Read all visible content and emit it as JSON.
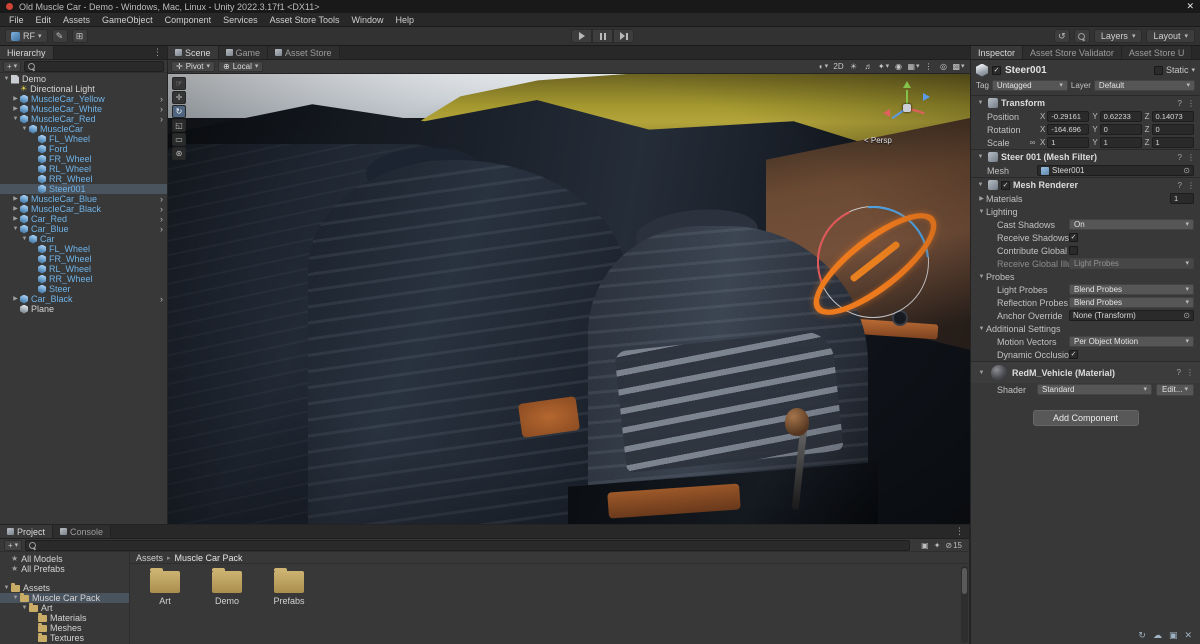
{
  "title_bar": {
    "title": "Old Muscle Car - Demo - Windows, Mac, Linux - Unity 2022.3.17f1 <DX11>"
  },
  "menu_bar": [
    "File",
    "Edit",
    "Assets",
    "GameObject",
    "Component",
    "Services",
    "Asset Store Tools",
    "Window",
    "Help"
  ],
  "toolbar": {
    "account_label": "RF",
    "layers_label": "Layers",
    "layout_label": "Layout"
  },
  "hierarchy": {
    "tab_label": "Hierarchy",
    "create_label": "+",
    "items": [
      {
        "label": "Demo",
        "depth": 0,
        "icon": "scene",
        "arrow": "down"
      },
      {
        "label": "Directional Light",
        "depth": 1,
        "icon": "light"
      },
      {
        "label": "MuscleCar_Yellow",
        "depth": 1,
        "icon": "prefab",
        "blue": true,
        "arrow": "right",
        "chev": true
      },
      {
        "label": "MuscleCar_White",
        "depth": 1,
        "icon": "prefab",
        "blue": true,
        "arrow": "right",
        "chev": true
      },
      {
        "label": "MuscleCar_Red",
        "depth": 1,
        "icon": "prefab",
        "blue": true,
        "arrow": "down",
        "chev": true
      },
      {
        "label": "MuscleCar",
        "depth": 2,
        "icon": "prefab",
        "blue": true,
        "arrow": "down"
      },
      {
        "label": "FL_Wheel",
        "depth": 3,
        "icon": "prefab",
        "blue": true
      },
      {
        "label": "Ford",
        "depth": 3,
        "icon": "prefab",
        "blue": true
      },
      {
        "label": "FR_Wheel",
        "depth": 3,
        "icon": "prefab",
        "blue": true
      },
      {
        "label": "RL_Wheel",
        "depth": 3,
        "icon": "prefab",
        "blue": true
      },
      {
        "label": "RR_Wheel",
        "depth": 3,
        "icon": "prefab",
        "blue": true
      },
      {
        "label": "Steer001",
        "depth": 3,
        "icon": "prefab",
        "blue": true,
        "selected": true
      },
      {
        "label": "MuscleCar_Blue",
        "depth": 1,
        "icon": "prefab",
        "blue": true,
        "arrow": "right",
        "chev": true
      },
      {
        "label": "MuscleCar_Black",
        "depth": 1,
        "icon": "prefab",
        "blue": true,
        "arrow": "right",
        "chev": true
      },
      {
        "label": "Car_Red",
        "depth": 1,
        "icon": "prefab",
        "blue": true,
        "arrow": "right",
        "chev": true
      },
      {
        "label": "Car_Blue",
        "depth": 1,
        "icon": "prefab",
        "blue": true,
        "arrow": "down",
        "chev": true
      },
      {
        "label": "Car",
        "depth": 2,
        "icon": "prefab",
        "blue": true,
        "arrow": "down"
      },
      {
        "label": "FL_Wheel",
        "depth": 3,
        "icon": "prefab",
        "blue": true
      },
      {
        "label": "FR_Wheel",
        "depth": 3,
        "icon": "prefab",
        "blue": true
      },
      {
        "label": "RL_Wheel",
        "depth": 3,
        "icon": "prefab",
        "blue": true
      },
      {
        "label": "RR_Wheel",
        "depth": 3,
        "icon": "prefab",
        "blue": true
      },
      {
        "label": "Steer",
        "depth": 3,
        "icon": "prefab",
        "blue": true
      },
      {
        "label": "Car_Black",
        "depth": 1,
        "icon": "prefab",
        "blue": true,
        "arrow": "right",
        "chev": true
      },
      {
        "label": "Plane",
        "depth": 1,
        "icon": "plane"
      }
    ]
  },
  "scene": {
    "tabs": [
      "Scene",
      "Game",
      "Asset Store"
    ],
    "active_tab": 0,
    "pivot_label": "Pivot",
    "local_label": "Local",
    "two_d_label": "2D",
    "persp_label": "< Persp",
    "tools": [
      "view",
      "move",
      "rotate",
      "scale",
      "rect",
      "transform"
    ],
    "selected_tool": 2,
    "right_icons": [
      "shading-mode",
      "lighting",
      "audio",
      "effects",
      "hidden-objects",
      "grid",
      "overlay-menu",
      "camera",
      "gizmos"
    ]
  },
  "inspector": {
    "tabs": [
      "Inspector",
      "Asset Store Validator",
      "Asset Store U"
    ],
    "active_tab": 0,
    "header": {
      "name": "Steer001",
      "static_label": "Static"
    },
    "tag": {
      "label": "Tag",
      "value": "Untagged"
    },
    "layer": {
      "label": "Layer",
      "value": "Default"
    },
    "axes": [
      "X",
      "Y",
      "Z"
    ],
    "transform": {
      "title": "Transform",
      "position_label": "Position",
      "position": {
        "x": "-0.29161",
        "y": "0.62233",
        "z": "0.14073"
      },
      "rotation_label": "Rotation",
      "rotation": {
        "x": "-164.696",
        "y": "0",
        "z": "0"
      },
      "scale_label": "Scale",
      "scale": {
        "x": "1",
        "y": "1",
        "z": "1"
      }
    },
    "mesh_filter": {
      "title": "Steer 001 (Mesh Filter)",
      "mesh_label": "Mesh",
      "mesh_value": "Steer001"
    },
    "mesh_renderer": {
      "title": "Mesh Renderer",
      "materials_label": "Materials",
      "materials_count": "1",
      "lighting_label": "Lighting",
      "cast_shadows_label": "Cast Shadows",
      "cast_shadows_value": "On",
      "receive_shadows_label": "Receive Shadows",
      "contribute_gi_label": "Contribute Global Illumination",
      "receive_gi_label": "Receive Global Illumination",
      "receive_gi_value": "Light Probes",
      "probes_label": "Probes",
      "light_probes_label": "Light Probes",
      "light_probes_value": "Blend Probes",
      "reflection_probes_label": "Reflection Probes",
      "reflection_probes_value": "Blend Probes",
      "anchor_override_label": "Anchor Override",
      "anchor_override_value": "None (Transform)",
      "additional_settings_label": "Additional Settings",
      "motion_vectors_label": "Motion Vectors",
      "motion_vectors_value": "Per Object Motion",
      "dynamic_occlusion_label": "Dynamic Occlusion"
    },
    "material": {
      "title": "RedM_Vehicle (Material)",
      "shader_label": "Shader",
      "shader_value": "Standard",
      "edit_label": "Edit..."
    },
    "add_component_label": "Add Component"
  },
  "project": {
    "tabs": [
      "Project",
      "Console"
    ],
    "active_tab": 0,
    "create_label": "+",
    "breadcrumb": [
      "Assets",
      "Muscle Car Pack"
    ],
    "hidden_count": "15",
    "tree": [
      {
        "label": "All Models",
        "depth": 0,
        "icon": "search"
      },
      {
        "label": "All Prefabs",
        "depth": 0,
        "icon": "search"
      },
      {
        "label": "Assets",
        "depth": 0,
        "icon": "folder",
        "arrow": "down",
        "gap_before": true
      },
      {
        "label": "Muscle Car Pack",
        "depth": 1,
        "icon": "folder",
        "arrow": "down",
        "selected": true
      },
      {
        "label": "Art",
        "depth": 2,
        "icon": "folder",
        "arrow": "down"
      },
      {
        "label": "Materials",
        "depth": 3,
        "icon": "folder"
      },
      {
        "label": "Meshes",
        "depth": 3,
        "icon": "folder"
      },
      {
        "label": "Textures",
        "depth": 3,
        "icon": "folder"
      }
    ],
    "folders": [
      "Art",
      "Demo",
      "Prefabs"
    ]
  },
  "status_icons": [
    "sync",
    "cloud",
    "grid",
    "close"
  ]
}
